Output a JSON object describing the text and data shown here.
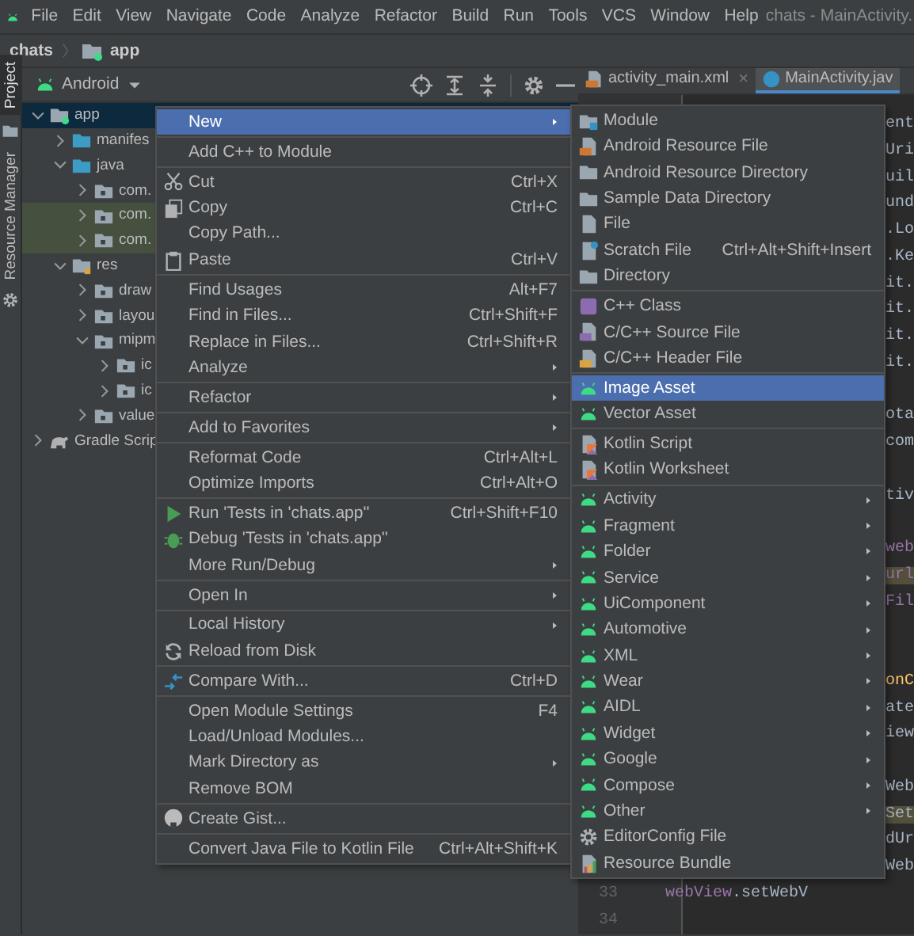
{
  "menubar": {
    "items": [
      "File",
      "Edit",
      "View",
      "Navigate",
      "Code",
      "Analyze",
      "Refactor",
      "Build",
      "Run",
      "Tools",
      "VCS",
      "Window",
      "Help"
    ],
    "title": "chats - MainActivity."
  },
  "breadcrumb": [
    "chats",
    "app"
  ],
  "side_strip": [
    {
      "label": "Project",
      "selected": true
    },
    {
      "label": "Resource Manager",
      "selected": false
    }
  ],
  "project_view": {
    "selector": "Android",
    "tree": [
      {
        "label": "app",
        "kind": "module",
        "expanded": true,
        "selected": true,
        "highlighted": false,
        "children": [
          {
            "label": "manifes",
            "kind": "source_root",
            "expanded": false,
            "selected": false,
            "highlighted": false
          },
          {
            "label": "java",
            "kind": "source_root",
            "expanded": true,
            "selected": false,
            "highlighted": false,
            "children": [
              {
                "label": "com.",
                "kind": "package",
                "expanded": false,
                "selected": false,
                "highlighted": false
              },
              {
                "label": "com.",
                "kind": "package",
                "expanded": false,
                "selected": false,
                "highlighted": true
              },
              {
                "label": "com.",
                "kind": "package",
                "expanded": false,
                "selected": false,
                "highlighted": true
              }
            ]
          },
          {
            "label": "res",
            "kind": "resource_root",
            "expanded": true,
            "selected": false,
            "highlighted": false,
            "children": [
              {
                "label": "draw",
                "kind": "package",
                "expanded": false,
                "selected": false,
                "highlighted": false
              },
              {
                "label": "layou",
                "kind": "package",
                "expanded": false,
                "selected": false,
                "highlighted": false
              },
              {
                "label": "mipm",
                "kind": "package",
                "expanded": true,
                "selected": false,
                "highlighted": false,
                "children": [
                  {
                    "label": "ic",
                    "kind": "package",
                    "expanded": false,
                    "selected": false,
                    "highlighted": false
                  },
                  {
                    "label": "ic",
                    "kind": "package",
                    "expanded": false,
                    "selected": false,
                    "highlighted": false
                  }
                ]
              },
              {
                "label": "value",
                "kind": "package",
                "expanded": false,
                "selected": false,
                "highlighted": false
              }
            ]
          }
        ]
      },
      {
        "label": "Gradle Scrip",
        "kind": "gradle",
        "expanded": false,
        "selected": false,
        "highlighted": false
      }
    ]
  },
  "editor": {
    "tabs": [
      {
        "label": "activity_main.xml",
        "kind": "xml",
        "selected": false,
        "close": "×"
      },
      {
        "label": "MainActivity.jav",
        "kind": "class",
        "selected": true
      }
    ],
    "lines": [
      {
        "kind": "fragment",
        "tokens": [
          {
            "text": "ent",
            "kind": "plain"
          }
        ]
      },
      {
        "kind": "fragment",
        "tokens": [
          {
            "text": "Uri",
            "kind": "plain"
          }
        ]
      },
      {
        "kind": "fragment",
        "tokens": [
          {
            "text": "uil",
            "kind": "plain"
          }
        ]
      },
      {
        "kind": "fragment",
        "tokens": [
          {
            "text": "und",
            "kind": "plain"
          }
        ]
      },
      {
        "kind": "fragment",
        "tokens": [
          {
            "text": ".Lo",
            "kind": "plain"
          }
        ]
      },
      {
        "kind": "fragment",
        "tokens": [
          {
            "text": ".Ke",
            "kind": "plain"
          }
        ]
      },
      {
        "kind": "fragment",
        "tokens": [
          {
            "text": "it.",
            "kind": "plain"
          }
        ]
      },
      {
        "kind": "fragment",
        "tokens": [
          {
            "text": "it.",
            "kind": "plain"
          }
        ]
      },
      {
        "kind": "fragment",
        "tokens": [
          {
            "text": "it.",
            "kind": "plain"
          }
        ]
      },
      {
        "kind": "fragment",
        "tokens": [
          {
            "text": "it.",
            "kind": "plain"
          }
        ]
      },
      {
        "kind": "blank"
      },
      {
        "kind": "fragment",
        "tokens": [
          {
            "text": "ota",
            "kind": "plain"
          }
        ]
      },
      {
        "kind": "fragment",
        "tokens": [
          {
            "text": "com",
            "kind": "plain"
          }
        ]
      },
      {
        "kind": "blank"
      },
      {
        "kind": "fragment",
        "tokens": [
          {
            "text": "tiv",
            "kind": "plain"
          }
        ]
      },
      {
        "kind": "blank"
      },
      {
        "kind": "fragment",
        "tokens": [
          {
            "text": "web",
            "kind": "field"
          }
        ]
      },
      {
        "kind": "fragment",
        "tokens": [
          {
            "text": "url",
            "kind": "field_usage"
          }
        ]
      },
      {
        "kind": "fragment",
        "tokens": [
          {
            "text": "Fil",
            "kind": "field"
          }
        ]
      },
      {
        "kind": "blank"
      },
      {
        "kind": "blank"
      },
      {
        "kind": "fragment",
        "tokens": [
          {
            "text": "onC",
            "kind": "method"
          }
        ]
      },
      {
        "kind": "fragment",
        "tokens": [
          {
            "text": "ate",
            "kind": "plain"
          }
        ]
      },
      {
        "kind": "fragment",
        "tokens": [
          {
            "text": "iew",
            "kind": "plain"
          }
        ]
      },
      {
        "kind": "blank"
      },
      {
        "kind": "fragment",
        "tokens": [
          {
            "text": "Web",
            "kind": "plain"
          }
        ]
      },
      {
        "kind": "fragment",
        "tokens": [
          {
            "text": "Set",
            "kind": "usage"
          }
        ]
      },
      {
        "kind": "fragment",
        "tokens": [
          {
            "text": "dUr",
            "kind": "plain"
          }
        ]
      },
      {
        "kind": "fragment",
        "tokens": [
          {
            "text": "Web",
            "kind": "plain"
          }
        ]
      },
      {
        "kind": "line",
        "number": "33",
        "tokens": [
          {
            "text": "webView",
            "kind": "field"
          },
          {
            "text": ".setWebV",
            "kind": "plain"
          }
        ]
      },
      {
        "kind": "line",
        "number": "34"
      }
    ]
  },
  "context_menu": {
    "groups": [
      {
        "items": [
          {
            "label": "New",
            "selected": true,
            "submenu": true
          }
        ]
      },
      {
        "items": [
          {
            "label": "Add C++ to Module",
            "selected": false,
            "submenu": false
          }
        ]
      },
      {
        "items": [
          {
            "label": "Cut",
            "kind": "cut",
            "shortcut": "Ctrl+X",
            "selected": false,
            "submenu": false
          },
          {
            "label": "Copy",
            "kind": "copy",
            "shortcut": "Ctrl+C",
            "selected": false,
            "submenu": false
          },
          {
            "label": "Copy Path...",
            "selected": false,
            "submenu": false
          },
          {
            "label": "Paste",
            "kind": "paste",
            "shortcut": "Ctrl+V",
            "selected": false,
            "submenu": false
          }
        ]
      },
      {
        "items": [
          {
            "label": "Find Usages",
            "shortcut": "Alt+F7",
            "selected": false,
            "submenu": false
          },
          {
            "label": "Find in Files...",
            "shortcut": "Ctrl+Shift+F",
            "selected": false,
            "submenu": false
          },
          {
            "label": "Replace in Files...",
            "shortcut": "Ctrl+Shift+R",
            "selected": false,
            "submenu": false
          },
          {
            "label": "Analyze",
            "selected": false,
            "submenu": true
          }
        ]
      },
      {
        "items": [
          {
            "label": "Refactor",
            "selected": false,
            "submenu": true
          }
        ]
      },
      {
        "items": [
          {
            "label": "Add to Favorites",
            "selected": false,
            "submenu": true
          }
        ]
      },
      {
        "items": [
          {
            "label": "Reformat Code",
            "shortcut": "Ctrl+Alt+L",
            "selected": false,
            "submenu": false
          },
          {
            "label": "Optimize Imports",
            "shortcut": "Ctrl+Alt+O",
            "selected": false,
            "submenu": false
          }
        ]
      },
      {
        "items": [
          {
            "label": "Run 'Tests in 'chats.app''",
            "kind": "run",
            "shortcut": "Ctrl+Shift+F10",
            "selected": false,
            "submenu": false
          },
          {
            "label": "Debug 'Tests in 'chats.app''",
            "kind": "debug",
            "selected": false,
            "submenu": false
          },
          {
            "label": "More Run/Debug",
            "selected": false,
            "submenu": true
          }
        ]
      },
      {
        "items": [
          {
            "label": "Open In",
            "selected": false,
            "submenu": true
          }
        ]
      },
      {
        "items": [
          {
            "label": "Local History",
            "selected": false,
            "submenu": true
          },
          {
            "label": "Reload from Disk",
            "kind": "reload",
            "selected": false,
            "submenu": false
          }
        ]
      },
      {
        "items": [
          {
            "label": "Compare With...",
            "kind": "compare",
            "shortcut": "Ctrl+D",
            "selected": false,
            "submenu": false
          }
        ]
      },
      {
        "items": [
          {
            "label": "Open Module Settings",
            "shortcut": "F4",
            "selected": false,
            "submenu": false
          },
          {
            "label": "Load/Unload Modules...",
            "selected": false,
            "submenu": false
          },
          {
            "label": "Mark Directory as",
            "selected": false,
            "submenu": true
          },
          {
            "label": "Remove BOM",
            "selected": false,
            "submenu": false
          }
        ]
      },
      {
        "items": [
          {
            "label": "Create Gist...",
            "kind": "gist",
            "selected": false,
            "submenu": false
          }
        ]
      },
      {
        "items": [
          {
            "label": "Convert Java File to Kotlin File",
            "shortcut": "Ctrl+Alt+Shift+K",
            "selected": false,
            "submenu": false
          }
        ]
      }
    ]
  },
  "new_submenu": {
    "groups": [
      {
        "items": [
          {
            "label": "Module",
            "kind": "module",
            "selected": false,
            "submenu": false
          },
          {
            "label": "Android Resource File",
            "kind": "resource_file",
            "selected": false,
            "submenu": false
          },
          {
            "label": "Android Resource Directory",
            "kind": "folder",
            "selected": false,
            "submenu": false
          },
          {
            "label": "Sample Data Directory",
            "kind": "folder",
            "selected": false,
            "submenu": false
          },
          {
            "label": "File",
            "kind": "file",
            "selected": false,
            "submenu": false
          },
          {
            "label": "Scratch File",
            "kind": "scratch",
            "shortcut": "Ctrl+Alt+Shift+Insert",
            "selected": false,
            "submenu": false
          },
          {
            "label": "Directory",
            "kind": "folder",
            "selected": false,
            "submenu": false
          }
        ]
      },
      {
        "items": [
          {
            "label": "C++ Class",
            "kind": "cpp_class",
            "selected": false,
            "submenu": false
          },
          {
            "label": "C/C++ Source File",
            "kind": "cpp_source",
            "selected": false,
            "submenu": false
          },
          {
            "label": "C/C++ Header File",
            "kind": "cpp_header",
            "selected": false,
            "submenu": false
          }
        ]
      },
      {
        "items": [
          {
            "label": "Image Asset",
            "kind": "android",
            "selected": true,
            "submenu": false
          },
          {
            "label": "Vector Asset",
            "kind": "android",
            "selected": false,
            "submenu": false
          }
        ]
      },
      {
        "items": [
          {
            "label": "Kotlin Script",
            "kind": "kotlin",
            "selected": false,
            "submenu": false
          },
          {
            "label": "Kotlin Worksheet",
            "kind": "kotlin",
            "selected": false,
            "submenu": false
          }
        ]
      },
      {
        "items": [
          {
            "label": "Activity",
            "kind": "android",
            "selected": false,
            "submenu": true
          },
          {
            "label": "Fragment",
            "kind": "android",
            "selected": false,
            "submenu": true
          },
          {
            "label": "Folder",
            "kind": "android",
            "selected": false,
            "submenu": true
          },
          {
            "label": "Service",
            "kind": "android",
            "selected": false,
            "submenu": true
          },
          {
            "label": "UiComponent",
            "kind": "android",
            "selected": false,
            "submenu": true
          },
          {
            "label": "Automotive",
            "kind": "android",
            "selected": false,
            "submenu": true
          },
          {
            "label": "XML",
            "kind": "android",
            "selected": false,
            "submenu": true
          },
          {
            "label": "Wear",
            "kind": "android",
            "selected": false,
            "submenu": true
          },
          {
            "label": "AIDL",
            "kind": "android",
            "selected": false,
            "submenu": true
          },
          {
            "label": "Widget",
            "kind": "android",
            "selected": false,
            "submenu": true
          },
          {
            "label": "Google",
            "kind": "android",
            "selected": false,
            "submenu": true
          },
          {
            "label": "Compose",
            "kind": "android",
            "selected": false,
            "submenu": true
          },
          {
            "label": "Other",
            "kind": "android",
            "selected": false,
            "submenu": true
          },
          {
            "label": "EditorConfig File",
            "kind": "gear",
            "selected": false,
            "submenu": false
          },
          {
            "label": "Resource Bundle",
            "kind": "bundle",
            "selected": false,
            "submenu": false
          }
        ]
      }
    ]
  }
}
